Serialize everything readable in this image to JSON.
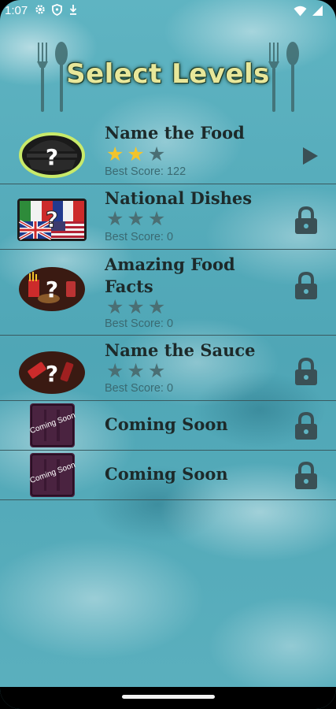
{
  "status_bar": {
    "time": "1:07",
    "left_icons": [
      "gear-icon",
      "shield-icon",
      "download-icon"
    ],
    "right_icons": [
      "wifi-icon",
      "signal-icon"
    ]
  },
  "header": {
    "title": "Select Levels",
    "title_color": "#e8e79a"
  },
  "levels": [
    {
      "name": "Name the Food",
      "stars_earned": 2,
      "stars_total": 3,
      "best_score": "Best Score: 122",
      "action": "play-icon",
      "thumbnail": "burger-question-icon"
    },
    {
      "name": "National Dishes",
      "stars_earned": 0,
      "stars_total": 3,
      "best_score": "Best Score: 0",
      "action": "lock-icon",
      "thumbnail": "flags-question-icon"
    },
    {
      "name": "Amazing Food Facts",
      "stars_earned": 0,
      "stars_total": 3,
      "best_score": "Best Score: 0",
      "action": "lock-icon",
      "thumbnail": "fastfood-question-icon"
    },
    {
      "name": "Name the Sauce",
      "stars_earned": 0,
      "stars_total": 3,
      "best_score": "Best Score: 0",
      "action": "lock-icon",
      "thumbnail": "sauce-question-icon"
    },
    {
      "name": "Coming Soon",
      "thumbnail_text": "Coming Soon",
      "action": "lock-icon",
      "thumbnail": "coming-soon-icon"
    },
    {
      "name": "Coming Soon",
      "thumbnail_text": "Coming Soon",
      "action": "lock-icon",
      "thumbnail": "coming-soon-icon"
    }
  ],
  "colors": {
    "star_on": "#f2c42c",
    "star_off": "#4a6f74",
    "divider": "#3a5a60",
    "background": "#5fb4c2"
  }
}
